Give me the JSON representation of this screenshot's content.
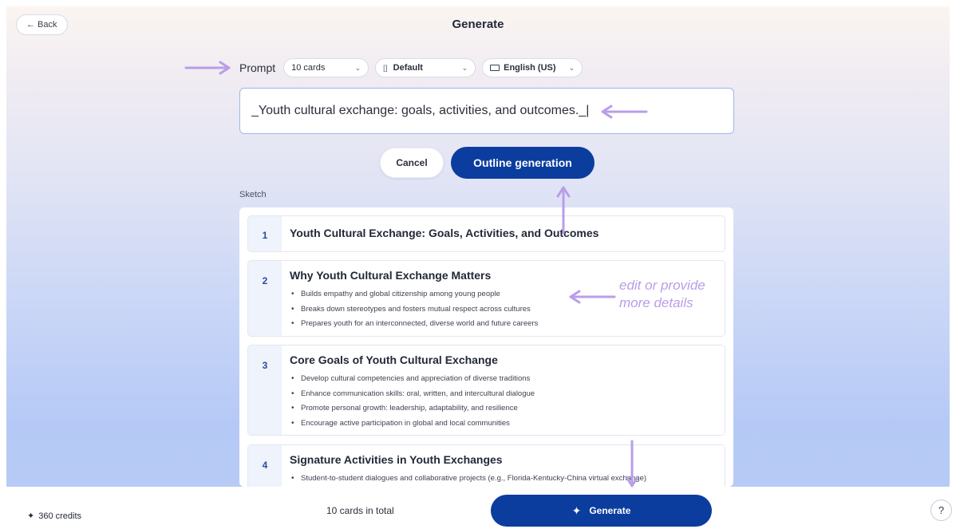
{
  "header": {
    "back_label": "← Back",
    "title": "Generate"
  },
  "prompt": {
    "label": "Prompt",
    "cards_select": "10 cards",
    "theme_select": "Default",
    "language_select": "English (US)",
    "input_value": "_Youth cultural exchange: goals, activities, and outcomes._|",
    "cancel_label": "Cancel",
    "outline_label": "Outline generation"
  },
  "sketch": {
    "label": "Sketch",
    "cards": [
      {
        "number": "1",
        "title": "Youth Cultural Exchange: Goals, Activities, and Outcomes",
        "bullets": []
      },
      {
        "number": "2",
        "title": "Why Youth Cultural Exchange Matters",
        "bullets": [
          "Builds empathy and global citizenship among young people",
          "Breaks down stereotypes and fosters mutual respect across cultures",
          "Prepares youth for an interconnected, diverse world and future careers"
        ]
      },
      {
        "number": "3",
        "title": "Core Goals of Youth Cultural Exchange",
        "bullets": [
          "Develop cultural competencies and appreciation of diverse traditions",
          "Enhance communication skills: oral, written, and intercultural dialogue",
          "Promote personal growth: leadership, adaptability, and resilience",
          "Encourage active participation in global and local communities"
        ]
      },
      {
        "number": "4",
        "title": "Signature Activities in Youth Exchanges",
        "bullets": [
          "Student-to-student dialogues and collaborative projects (e.g., Florida-Kentucky-China virtual exchange)"
        ]
      }
    ]
  },
  "annotation": "edit or provide\nmore details",
  "footer": {
    "credits": "360 credits",
    "total": "10 cards in total",
    "generate_label": "Generate",
    "help_label": "?"
  },
  "colors": {
    "primary": "#0b3d9f",
    "annotation": "#b89ee8",
    "number_column": "#eef3fc"
  }
}
